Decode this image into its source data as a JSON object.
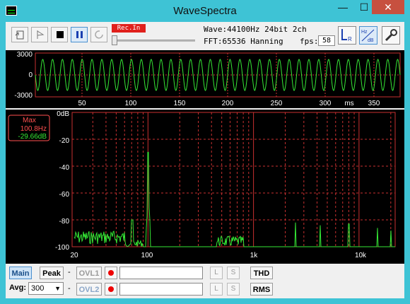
{
  "window": {
    "title": "WaveSpectra",
    "min": "—",
    "max": "☐",
    "close": "✕"
  },
  "toolbar": {
    "rec_label": "Rec.In",
    "wave_info": "Wave:44100Hz 24bit 2ch",
    "fft_info": "FFT:65536 Hanning",
    "fps_label": "fps:",
    "fps_value": "58"
  },
  "wave_panel": {
    "y_labels": [
      "3000",
      "0",
      "-3000"
    ],
    "x_labels": [
      "50",
      "100",
      "150",
      "200",
      "250",
      "300",
      "350"
    ],
    "x_unit": "ms"
  },
  "spectrum_panel": {
    "max_title": "Max",
    "max_freq": "100.8Hz",
    "max_db": "-29.66dB",
    "y_labels": [
      "0dB",
      "-20",
      "-40",
      "-60",
      "-80",
      "-100"
    ],
    "x_labels": [
      "20",
      "100",
      "1k",
      "10k"
    ]
  },
  "bottom": {
    "main": "Main",
    "peak": "Peak",
    "dash": "-",
    "ovl1": "OVL1",
    "ovl2": "OVL2",
    "avg_label": "Avg:",
    "avg_value": "300",
    "l": "L",
    "s": "S",
    "thd": "THD",
    "rms": "RMS"
  },
  "colors": {
    "wave": "#35e835",
    "grid": "#c83030",
    "spectrum": "#35e835",
    "labels": "#ffffff",
    "max_box": "#ff5050"
  }
}
